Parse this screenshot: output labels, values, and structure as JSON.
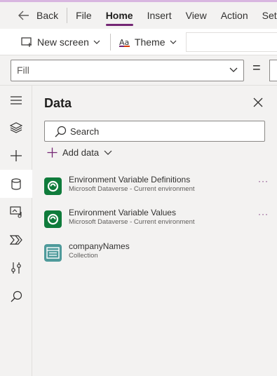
{
  "nav": {
    "back": "Back",
    "menus": [
      "File",
      "Home",
      "Insert",
      "View",
      "Action",
      "Setti"
    ],
    "active": "Home"
  },
  "toolbar": {
    "new_screen": "New screen",
    "theme": "Theme"
  },
  "formula": {
    "property": "Fill",
    "equals": "="
  },
  "rail": {
    "items": [
      "hamburger-icon",
      "layers-icon",
      "insert-icon",
      "data-icon",
      "media-icon",
      "power-automate-icon",
      "advanced-tools-icon",
      "search-icon"
    ],
    "selected": "data-icon"
  },
  "panel": {
    "title": "Data",
    "search_placeholder": "Search",
    "add_data": "Add data",
    "sources": [
      {
        "name": "Environment Variable Definitions",
        "subtitle": "Microsoft Dataverse - Current environment",
        "icon": "dataverse-icon",
        "more": "···"
      },
      {
        "name": "Environment Variable Values",
        "subtitle": "Microsoft Dataverse - Current environment",
        "icon": "dataverse-icon",
        "more": "···"
      },
      {
        "name": "companyNames",
        "subtitle": "Collection",
        "icon": "collection-icon"
      }
    ]
  },
  "colors": {
    "accent": "#742774",
    "dataverse": "#0f7b3b",
    "collection": "#4e9a9b"
  }
}
